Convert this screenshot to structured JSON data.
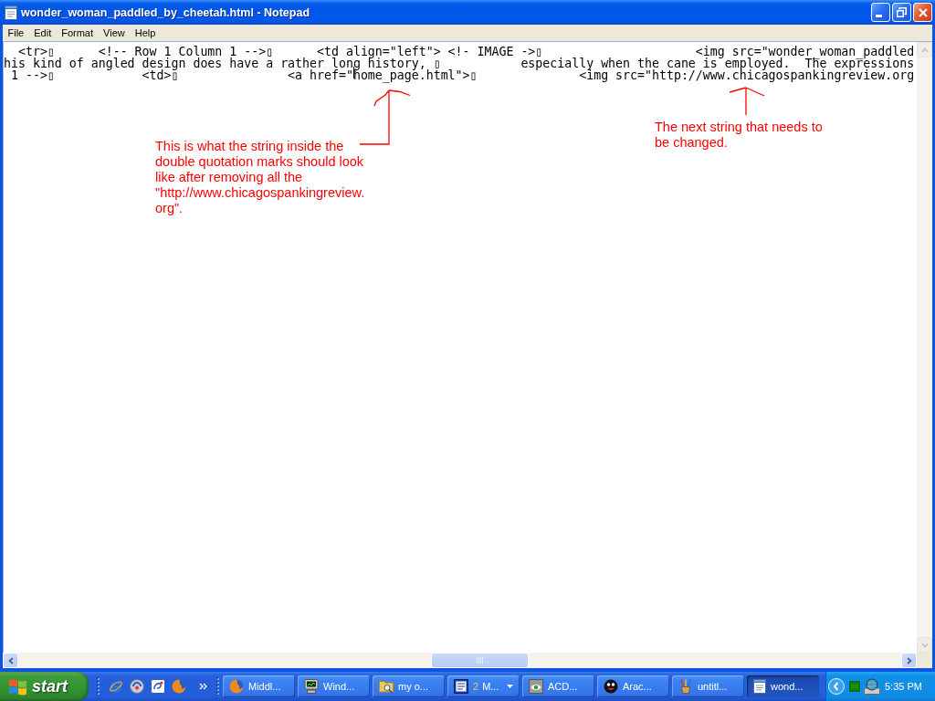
{
  "window": {
    "title": "wonder_woman_paddled_by_cheetah.html - Notepad"
  },
  "menu": [
    {
      "label": "File"
    },
    {
      "label": "Edit"
    },
    {
      "label": "Format"
    },
    {
      "label": "View"
    },
    {
      "label": "Help"
    }
  ],
  "editor": {
    "lines": [
      {
        "segments": [
          "  <tr>▯      <!-- Row 1 Column 1 -->▯      <td align=\"left\"> <!- IMAGE ->▯                     <img src=\"wonder_woman_paddled"
        ],
        "caret": false
      },
      {
        "segments": [
          "his kind of angled design does have a rather long history, ▯           especially when the cane is employed.  The expressions"
        ],
        "caret": false
      },
      {
        "segments": [
          " 1 -->▯            <td>▯               <a href=\"",
          "home_page.html\">▯              <img src=\"http://www.chicagospankingreview.org"
        ],
        "caret": true
      }
    ]
  },
  "annotations": [
    {
      "lines": [
        "This is what the string inside the",
        "double quotation marks should look",
        "like after removing all the",
        "\"http://www.chicagospankingreview.",
        "org\"."
      ]
    },
    {
      "lines": [
        "The next string that needs to",
        "be changed."
      ]
    }
  ],
  "taskbar": {
    "start": "start",
    "tasks": [
      {
        "label": "Middl...",
        "kind": "window",
        "selected": false
      },
      {
        "label": "Wind...",
        "kind": "window",
        "selected": false
      },
      {
        "label": "my o...",
        "kind": "window",
        "selected": false
      },
      {
        "label": "M...",
        "count": "2",
        "kind": "group",
        "selected": false
      },
      {
        "label": "ACD...",
        "kind": "window",
        "selected": false
      },
      {
        "label": "Arac...",
        "kind": "window",
        "selected": false
      },
      {
        "label": "untitl...",
        "kind": "window",
        "selected": false
      },
      {
        "label": "wond...",
        "kind": "window",
        "selected": true
      }
    ],
    "clock": "5:35 PM"
  }
}
